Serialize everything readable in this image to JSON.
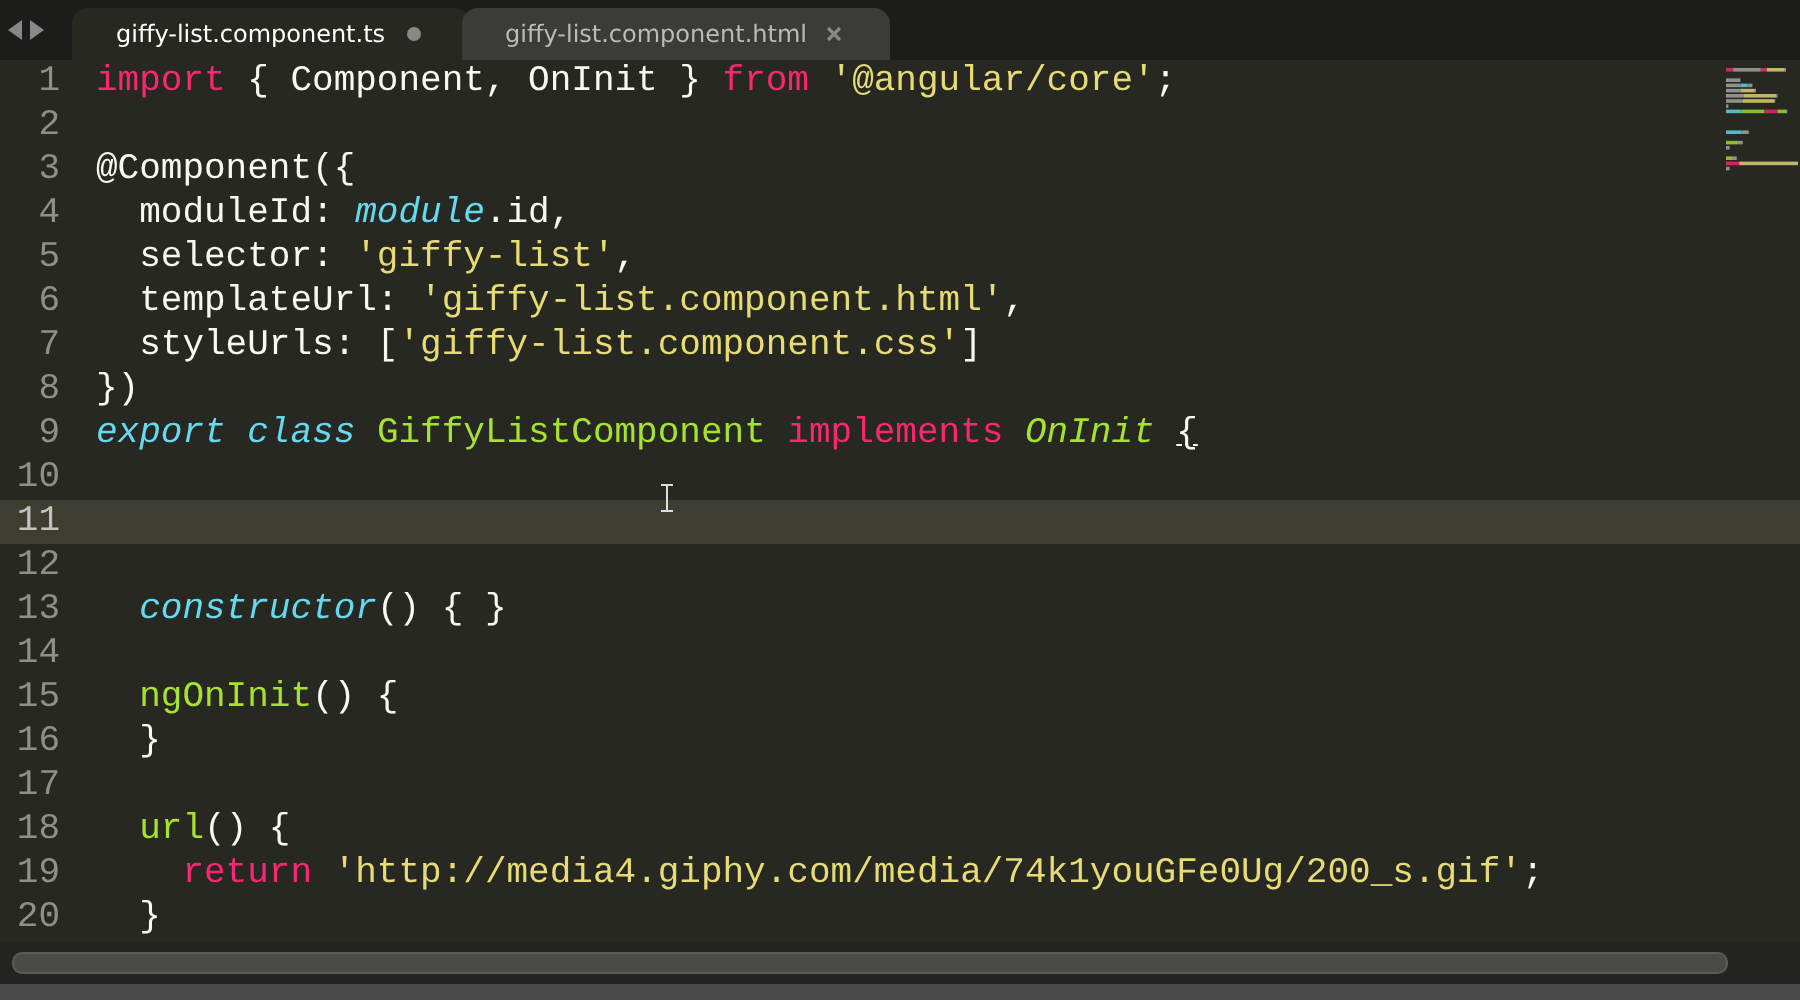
{
  "tabs": [
    {
      "label": "giffy-list.component.ts",
      "selected": true,
      "modified": true
    },
    {
      "label": "giffy-list.component.html",
      "selected": false,
      "modified": false
    }
  ],
  "lines": [
    {
      "number": "1",
      "current": false,
      "tokens": [
        {
          "kind": "keyword",
          "text": "import"
        },
        {
          "kind": "plain",
          "text": " { Component, OnInit } "
        },
        {
          "kind": "keyword",
          "text": "from "
        },
        {
          "kind": "string",
          "text": "'@angular/core'"
        },
        {
          "kind": "plain",
          "text": ";"
        }
      ]
    },
    {
      "number": "2",
      "current": false
    },
    {
      "number": "3",
      "current": false,
      "tokens": [
        {
          "kind": "plain",
          "text": "@Component({"
        }
      ]
    },
    {
      "number": "4",
      "current": false,
      "tokens": [
        {
          "kind": "plain",
          "text": "  moduleId: "
        },
        {
          "kind": "storage",
          "text": "module"
        },
        {
          "kind": "plain",
          "text": ".id,"
        }
      ]
    },
    {
      "number": "5",
      "current": false,
      "tokens": [
        {
          "kind": "plain",
          "text": "  selector: "
        },
        {
          "kind": "string",
          "text": "'giffy-list'"
        },
        {
          "kind": "plain",
          "text": ","
        }
      ]
    },
    {
      "number": "6",
      "current": false,
      "tokens": [
        {
          "kind": "plain",
          "text": "  templateUrl: "
        },
        {
          "kind": "string",
          "text": "'giffy-list.component.html'"
        },
        {
          "kind": "plain",
          "text": ","
        }
      ]
    },
    {
      "number": "7",
      "current": false,
      "tokens": [
        {
          "kind": "plain",
          "text": "  styleUrls: ["
        },
        {
          "kind": "string",
          "text": "'giffy-list.component.css'"
        },
        {
          "kind": "plain",
          "text": "]"
        }
      ]
    },
    {
      "number": "8",
      "current": false,
      "tokens": [
        {
          "kind": "plain",
          "text": "})"
        }
      ]
    },
    {
      "number": "9",
      "current": false,
      "tokens": [
        {
          "kind": "storage",
          "text": "export class "
        },
        {
          "kind": "entity",
          "text": "GiffyListComponent "
        },
        {
          "kind": "keyword",
          "text": "implements "
        },
        {
          "kind": "inherited",
          "text": "OnInit "
        },
        {
          "kind": "bracket",
          "text": "{"
        }
      ]
    },
    {
      "number": "10",
      "current": false
    },
    {
      "number": "11",
      "current": true
    },
    {
      "number": "12",
      "current": false
    },
    {
      "number": "13",
      "current": false,
      "tokens": [
        {
          "kind": "storage",
          "text": "  constructor"
        },
        {
          "kind": "plain",
          "text": "() { }"
        }
      ]
    },
    {
      "number": "14",
      "current": false
    },
    {
      "number": "15",
      "current": false,
      "tokens": [
        {
          "kind": "entity",
          "text": "  ngOnInit"
        },
        {
          "kind": "plain",
          "text": "() {"
        }
      ]
    },
    {
      "number": "16",
      "current": false,
      "tokens": [
        {
          "kind": "plain",
          "text": "  }"
        }
      ]
    },
    {
      "number": "17",
      "current": false
    },
    {
      "number": "18",
      "current": false,
      "tokens": [
        {
          "kind": "entity",
          "text": "  url"
        },
        {
          "kind": "plain",
          "text": "() {"
        }
      ]
    },
    {
      "number": "19",
      "current": false,
      "tokens": [
        {
          "kind": "keyword",
          "text": "    return "
        },
        {
          "kind": "string",
          "text": "'http://media4.giphy.com/media/74k1youGFe0Ug/200_s.gif'"
        },
        {
          "kind": "plain",
          "text": ";"
        }
      ]
    },
    {
      "number": "20",
      "current": false,
      "tokens": [
        {
          "kind": "plain",
          "text": "  }"
        }
      ]
    }
  ]
}
